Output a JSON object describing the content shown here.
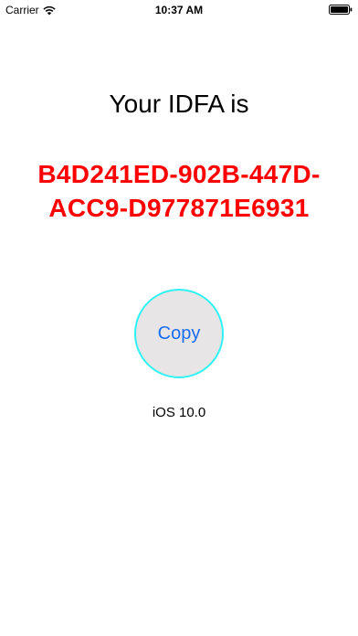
{
  "status_bar": {
    "carrier": "Carrier",
    "time": "10:37 AM",
    "wifi_icon": "wifi-icon",
    "battery_icon": "battery-full-icon"
  },
  "main": {
    "title": "Your IDFA is",
    "idfa_line1": "B4D241ED-902B-447D-",
    "idfa_line2": "ACC9-D977871E6931",
    "copy_label": "Copy",
    "ios_version": "iOS 10.0"
  },
  "colors": {
    "idfa_text": "#ff0000",
    "button_fill": "#e8e5e7",
    "button_border": "#2ff2f5",
    "button_text": "#1a6cf2"
  }
}
